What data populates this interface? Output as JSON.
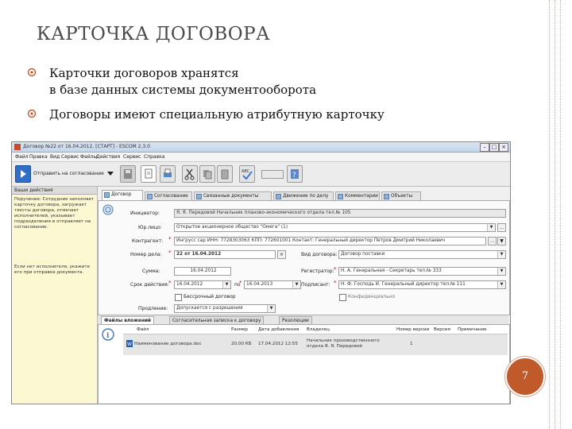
{
  "slide": {
    "title": "КАРТОЧКА ДОГОВОРА",
    "bullets": [
      {
        "line1": "Карточки договоров хранятся",
        "line2": "в базе данных системы документооборота"
      },
      {
        "line1": "Договоры имеют специальную атрибутную карточку"
      }
    ],
    "page_number": "7",
    "accent_color": "#c15a2a"
  },
  "window": {
    "title": "Договор №22 от 16.04.2012. [СТАРТ] - ESCOM 2.3.0",
    "menu": [
      "Файл",
      "Правка",
      "Вид",
      "Сервис",
      "Файлы",
      "Действия",
      "Сервис",
      "Справка"
    ],
    "toolbar": {
      "send_label": "Отправить на согласование",
      "icons": [
        "play-icon",
        "chevron-down-icon",
        "save-icon",
        "new-document-icon",
        "print-icon",
        "cut-icon",
        "copy-icon",
        "paste-icon",
        "spellcheck-icon",
        "zoom-field",
        "help-icon"
      ]
    },
    "sidebar": {
      "header": "Ваши действия",
      "instruction": "Поручение: Сотрудник заполняет карточку договора, загружает тексты договора, отмечает исполнителей, указывает подразделения и отправляет на согласование.",
      "hint": "Если нет исполнителя, укажите его при отправке документа."
    },
    "tabs": [
      "Договор",
      "Согласование",
      "Связанные документы",
      "Движение по делу",
      "Комментарии",
      "Объекты"
    ],
    "form": {
      "initiator_label": "Инициатор:",
      "initiator_value": "Я. Я. Передовой Начальник планово-экономического отдела тел.№ 105",
      "legal_label": "Юр.лицо:",
      "legal_value": "Открытое акционерное общество \"Омега\" (1)",
      "counterparty_label": "Контрагент:",
      "counterparty_value": "Ингрусс сар ИНН: 7728303063 КПП: 772601001 Контакт: Генеральный директор Петров Дмитрий Николаевич",
      "number_label": "Номер дела:",
      "number_value": "22 от 16.04.2012",
      "sum_label": "Сумма:",
      "sum_value": "16.04.2012",
      "term_label": "Срок действия:",
      "term_from": "16.04.2012",
      "term_to_label": "по",
      "term_to": "16.04.2013",
      "indefinite_label": "Бессрочный договор",
      "extension_label": "Продление:",
      "extension_value": "Допускается с разрешения",
      "type_label": "Вид договора:",
      "type_value": "Договор поставки",
      "registrar_label": "Регистратор:",
      "registrar_value": "Н. А. Генеральная - Секретарь тел.№ 333",
      "signatory_label": "Подписант:",
      "signatory_value": "Н. Ф. Господь И. Генеральный директор тел.№ 111",
      "confidential_label": "Конфиденциально"
    },
    "files_tabs": [
      "Файлы вложений",
      "Согласительная записка к договору",
      "Резолюции"
    ],
    "files_table": {
      "headers": [
        "Файл",
        "Размер",
        "Дата добавления",
        "Владелец",
        "Номер версии",
        "Версия",
        "Примечание"
      ],
      "rows": [
        {
          "file": "Наименование договора.doc",
          "size": "20,00 КБ",
          "date": "17.04.2012 12:55",
          "owner": "Начальник производственного отдела Я. Я. Передовой",
          "version_no": "1",
          "version": "",
          "note": ""
        }
      ]
    }
  }
}
